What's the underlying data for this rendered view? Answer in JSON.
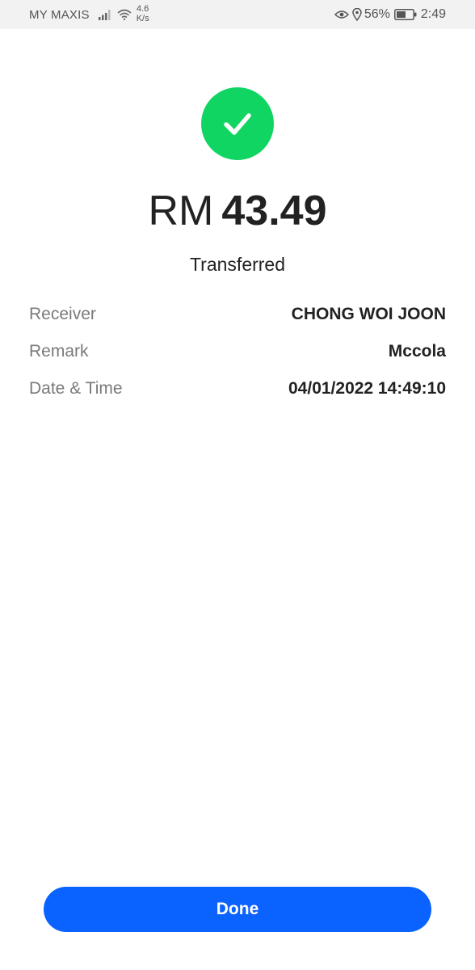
{
  "status_bar": {
    "carrier": "MY MAXIS",
    "network_speed_value": "4.6",
    "network_speed_unit": "K/s",
    "battery_percent": "56%",
    "time": "2:49",
    "icons": [
      "signal-icon",
      "wifi-icon",
      "eye-icon",
      "location-icon",
      "battery-icon"
    ]
  },
  "result": {
    "icon": "check-icon",
    "currency": "RM",
    "amount": "43.49",
    "status": "Transferred"
  },
  "details": [
    {
      "label": "Receiver",
      "value": "CHONG WOI JOON"
    },
    {
      "label": "Remark",
      "value": "Mccola"
    },
    {
      "label": "Date & Time",
      "value": "04/01/2022 14:49:10"
    }
  ],
  "actions": {
    "done_label": "Done"
  },
  "colors": {
    "success_green": "#10d562",
    "primary_blue": "#0a62ff",
    "status_bar_bg": "#f2f2f2",
    "label_gray": "#7a7a7a",
    "text_dark": "#222222"
  }
}
